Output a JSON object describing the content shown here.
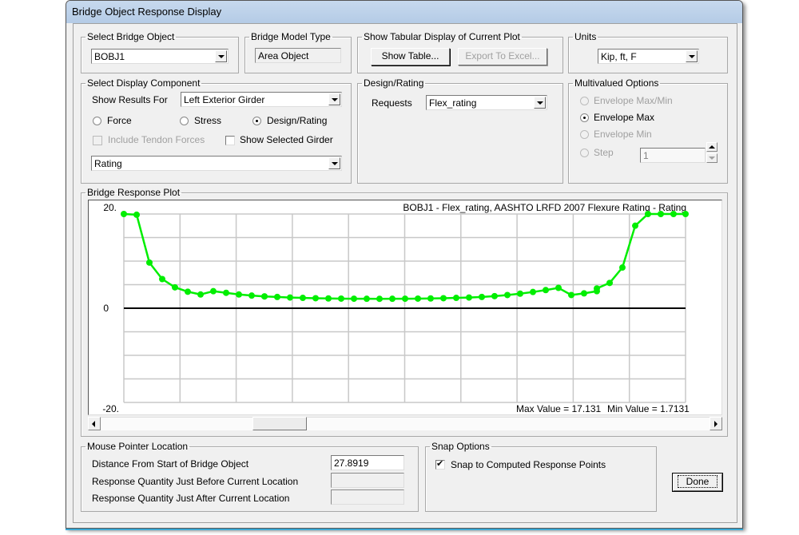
{
  "window": {
    "title": "Bridge Object Response Display"
  },
  "select_bridge_object": {
    "legend": "Select Bridge Object",
    "value": "BOBJ1"
  },
  "bridge_model_type": {
    "legend": "Bridge Model Type",
    "value": "Area Object"
  },
  "tabular_display": {
    "legend": "Show Tabular Display of Current Plot",
    "show_table_label": "Show Table...",
    "export_excel_label": "Export To Excel..."
  },
  "units": {
    "legend": "Units",
    "value": "Kip, ft, F"
  },
  "display_component": {
    "legend": "Select Display Component",
    "show_results_for_label": "Show Results For",
    "show_results_for_value": "Left Exterior Girder",
    "radios": [
      {
        "label": "Force",
        "checked": false
      },
      {
        "label": "Stress",
        "checked": false
      },
      {
        "label": "Design/Rating",
        "checked": true
      }
    ],
    "include_tendon_label": "Include Tendon Forces",
    "include_tendon_checked": false,
    "show_selected_girder_label": "Show Selected Girder",
    "show_selected_girder_checked": false,
    "component_value": "Rating"
  },
  "design_rating": {
    "legend": "Design/Rating",
    "requests_label": "Requests",
    "requests_value": "Flex_rating"
  },
  "multivalued": {
    "legend": "Multivalued Options",
    "options": [
      {
        "label": "Envelope Max/Min",
        "checked": false,
        "enabled": false
      },
      {
        "label": "Envelope Max",
        "checked": true,
        "enabled": true
      },
      {
        "label": "Envelope Min",
        "checked": false,
        "enabled": false
      },
      {
        "label": "Step",
        "checked": false,
        "enabled": false
      }
    ],
    "step_value": "1"
  },
  "plot": {
    "legend": "Bridge Response Plot",
    "max_label": "Max Value = 17.131",
    "min_label": "Min Value = 1.7131"
  },
  "chart_data": {
    "type": "line",
    "title": "BOBJ1 - Flex_rating, AASHTO LRFD 2007 Flexure Rating - Rating",
    "xlabel": "",
    "ylabel": "",
    "y_tick_labels": [
      "20.",
      "0",
      "-20."
    ],
    "ylim": [
      -17.131,
      17.131
    ],
    "xlim": [
      0,
      1
    ],
    "grid": true,
    "x_gridlines": 10,
    "y_gridlines": 8,
    "series": [
      {
        "name": "Envelope Max",
        "color": "#00ee00",
        "x": [
          0.0,
          0.0228,
          0.0455,
          0.0683,
          0.091,
          0.1138,
          0.1366,
          0.1593,
          0.1821,
          0.2048,
          0.2276,
          0.2504,
          0.2504,
          0.2731,
          0.2959,
          0.3186,
          0.3414,
          0.3642,
          0.3869,
          0.4097,
          0.4324,
          0.4552,
          0.478,
          0.5007,
          0.5235,
          0.5462,
          0.569,
          0.5917,
          0.6145,
          0.6373,
          0.66,
          0.6828,
          0.7055,
          0.7283,
          0.7511,
          0.7738,
          0.7966,
          0.8193,
          0.8421,
          0.8421,
          0.8649,
          0.8876,
          0.9104,
          0.9331,
          0.9559,
          0.9786,
          1.0
        ],
        "y": [
          17.131,
          17.0,
          8.3,
          5.3,
          3.8,
          3.0,
          2.5,
          3.1,
          2.8,
          2.5,
          2.3,
          2.15,
          2.15,
          2.05,
          1.95,
          1.88,
          1.82,
          1.78,
          1.75,
          1.73,
          1.72,
          1.7131,
          1.72,
          1.73,
          1.75,
          1.78,
          1.82,
          1.88,
          1.95,
          2.05,
          2.2,
          2.4,
          2.65,
          2.95,
          3.3,
          3.7,
          2.4,
          2.7,
          3.1,
          3.6,
          4.6,
          7.4,
          15.0,
          17.131,
          17.131,
          17.131,
          17.131
        ]
      }
    ]
  },
  "mouse_pointer": {
    "legend": "Mouse Pointer Location",
    "distance_label": "Distance From Start of Bridge Object",
    "distance_value": "27.8919",
    "before_label": "Response Quantity Just Before Current Location",
    "before_value": "",
    "after_label": "Response Quantity Just After Current Location",
    "after_value": ""
  },
  "snap": {
    "legend": "Snap Options",
    "snap_label": "Snap to Computed Response Points",
    "snap_checked": true
  },
  "done_label": "Done"
}
